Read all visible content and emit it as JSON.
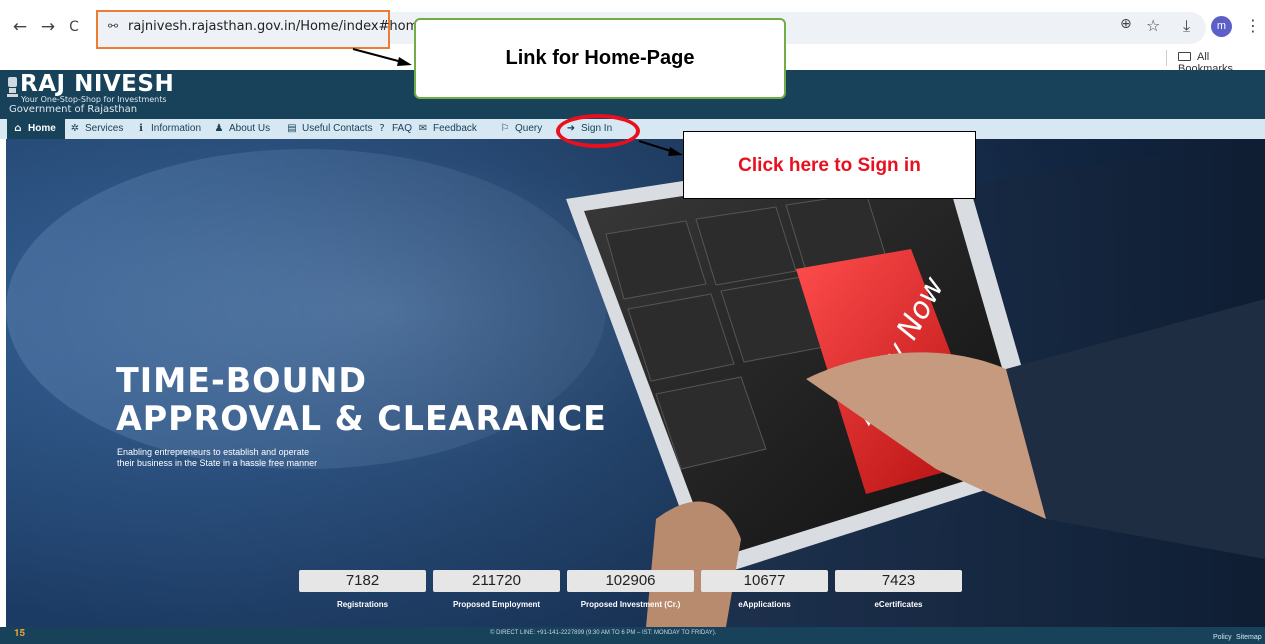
{
  "browser": {
    "url": "rajnivesh.rajasthan.gov.in/Home/index#home",
    "back_icon": "←",
    "forward_icon": "→",
    "reload_icon": "C",
    "site_info_icon": "⚯",
    "zoom_icon": "⊕",
    "star_icon": "☆",
    "download_icon": "⤓",
    "profile_initial": "m",
    "menu_icon": "⋮",
    "bookmarks_label": "All Bookmarks"
  },
  "site": {
    "logo_title": "RAJ NIVESH",
    "logo_tagline": "Your One-Stop-Shop for Investments",
    "logo_government": "Government of Rajasthan"
  },
  "menu": {
    "items": [
      {
        "label": "Home",
        "icon": "⌂"
      },
      {
        "label": "Services",
        "icon": "✲"
      },
      {
        "label": "Information",
        "icon": "ℹ"
      },
      {
        "label": "About Us",
        "icon": "♟"
      },
      {
        "label": "Useful Contacts",
        "icon": "▤"
      },
      {
        "label": "FAQ",
        "icon": "?"
      },
      {
        "label": "Feedback",
        "icon": "✉"
      },
      {
        "label": "Query",
        "icon": "⚐"
      },
      {
        "label": "Sign In",
        "icon": "➜"
      }
    ]
  },
  "hero": {
    "title_line1": "TIME-BOUND",
    "title_line2": "APPROVAL & CLEARANCE",
    "subtitle_line1": "Enabling entrepreneurs to establish and operate",
    "subtitle_line2": "their business in the State in a hassle free manner",
    "keyboard_key": "Apply Now"
  },
  "stats": [
    {
      "value": "7182",
      "label": "Registrations"
    },
    {
      "value": "211720",
      "label": "Proposed Employment"
    },
    {
      "value": "102906",
      "label": "Proposed Investment (Cr.)"
    },
    {
      "value": "10677",
      "label": "eApplications"
    },
    {
      "value": "7423",
      "label": "eCertificates"
    }
  ],
  "footer": {
    "logo": "𝟏𝟓",
    "direct_line": "© DIRECT LINE: +91-141-2227899 (9:30 AM TO 6 PM – IST: MONDAY TO FRIDAY).",
    "policy": "Policy",
    "sitemap": "Sitemap"
  },
  "annotations": {
    "home_link": "Link for Home-Page",
    "sign_in": "Click here to Sign in"
  },
  "colors": {
    "header": "#17425a",
    "menu": "#d7e8f3",
    "url_highlight": "#ed7d31",
    "callout_border": "#70ad47",
    "annotation_red": "#e8101f"
  }
}
